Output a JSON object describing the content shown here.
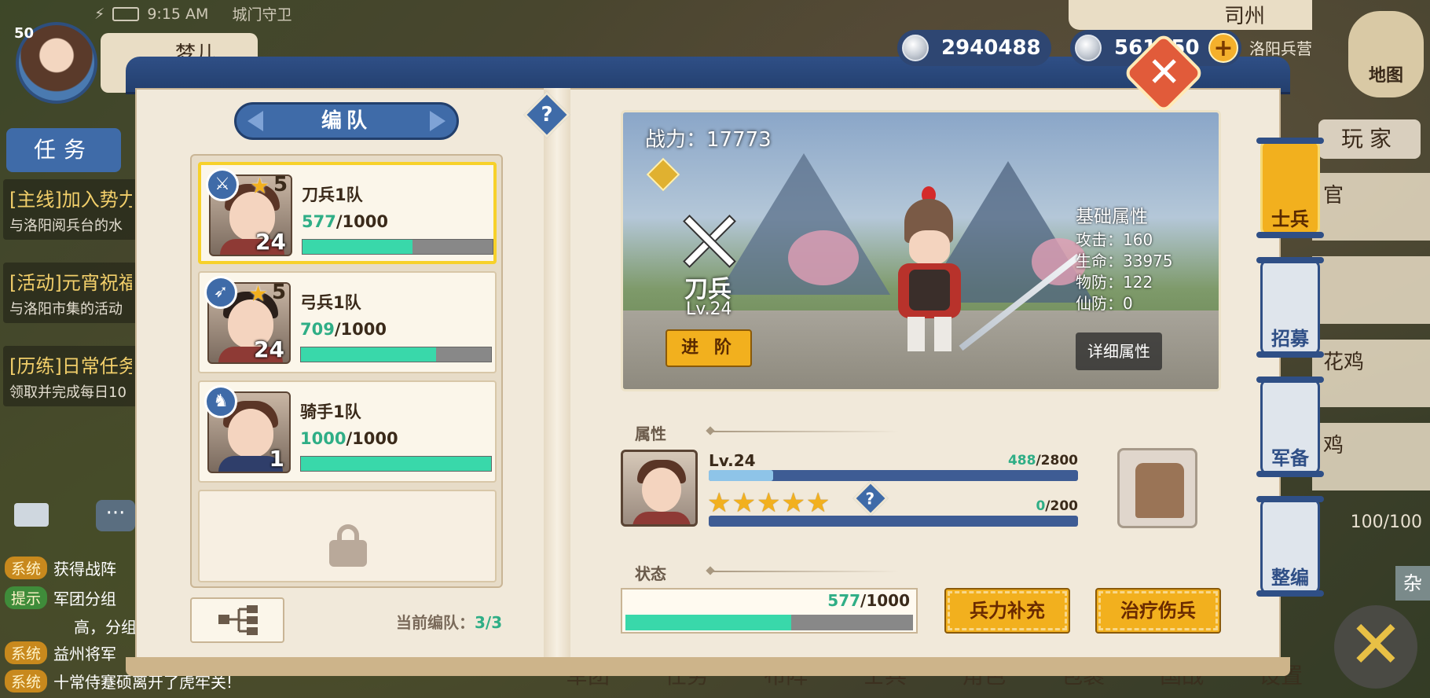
{
  "status_bar": {
    "time": "9:15 AM",
    "location_label": "城门守卫"
  },
  "player": {
    "level": "50",
    "name": "梦儿"
  },
  "left_hud": {
    "task_tab": "任务",
    "quests": [
      {
        "title": "[主线]加入势力",
        "desc": "与洛阳阅兵台的水"
      },
      {
        "title": "[活动]元宵祝福",
        "desc": "与洛阳市集的活动"
      },
      {
        "title": "[历练]日常任务",
        "desc": "领取并完成每日10"
      }
    ],
    "chat": [
      {
        "tag": "系统",
        "text": "获得战阵"
      },
      {
        "tag": "提示",
        "text": "军团分组"
      },
      {
        "tag": "",
        "text": "高，分组"
      },
      {
        "tag": "系统",
        "text": "益州将军"
      },
      {
        "tag": "系统",
        "text": "十常侍蹇硕离开了虎牢关!"
      }
    ]
  },
  "right_hud": {
    "region": "司州",
    "region_sub": "洛阳兵营",
    "map_label": "地图",
    "player_tab": "玩家",
    "cards": [
      "官",
      "",
      "花鸡",
      "鸡"
    ],
    "troop_count": "100/100",
    "misc_tab": "杂"
  },
  "bottom_nav": [
    "军团",
    "任务",
    "布阵",
    "士兵",
    "角色",
    "包裹",
    "国战",
    "设置"
  ],
  "currency": {
    "silver": "2940488",
    "jade": "561350",
    "add_label": "+"
  },
  "dialog": {
    "close_label": "✕",
    "help_label": "?",
    "formation": {
      "title": "编队",
      "squads": [
        {
          "name": "刀兵1队",
          "stars": "5",
          "level": "24",
          "hp_cur": "577",
          "hp_max": "/1000",
          "type": "sword",
          "selected": true,
          "hp_ratio": 0.577
        },
        {
          "name": "弓兵1队",
          "stars": "5",
          "level": "24",
          "hp_cur": "709",
          "hp_max": "/1000",
          "type": "bow",
          "selected": false,
          "hp_ratio": 0.709
        },
        {
          "name": "骑手1队",
          "stars": "",
          "level": "1",
          "hp_cur": "1000",
          "hp_max": "/1000",
          "type": "horse",
          "selected": false,
          "hp_ratio": 1.0
        }
      ],
      "current_label": "当前编队：",
      "current_value": "3/3"
    },
    "hero": {
      "power_label": "战力：",
      "power_value": "17773",
      "class_name": "刀兵",
      "class_level": "Lv.24",
      "advance_label": "进 阶",
      "attr_header": "基础属性",
      "attrs": [
        "攻击：160",
        "生命：33975",
        "物防：122",
        "仙防：0"
      ],
      "detail_label": "详细属性"
    },
    "attribute_section": {
      "label": "属性",
      "level": "Lv.24",
      "exp_cur": "488",
      "exp_max": "/2800",
      "exp_ratio": 0.174,
      "stars": "★★★★★",
      "star_progress_cur": "0",
      "star_progress_max": "/200",
      "star_ratio": 0.0
    },
    "state_section": {
      "label": "状态",
      "hp_cur": "577",
      "hp_max": "/1000",
      "hp_ratio": 0.577,
      "replenish_label": "兵力补充",
      "heal_label": "治疗伤兵"
    },
    "side_tabs": [
      "士兵",
      "招募",
      "军备",
      "整编"
    ]
  },
  "colors": {
    "accent_blue": "#3f6ba8",
    "gold": "#f2b01e",
    "hp_green": "#39d8aa",
    "paper": "#f1e9da"
  }
}
